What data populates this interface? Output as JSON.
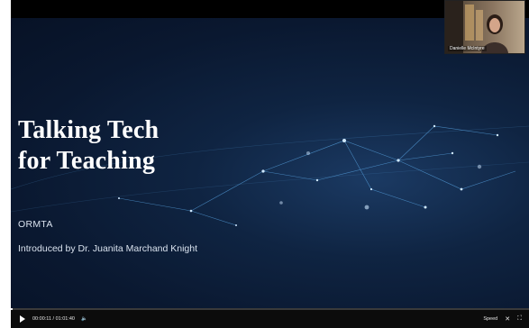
{
  "slide": {
    "title_line1": "Talking Tech",
    "title_line2": "for Teaching",
    "org": "ORMTA",
    "intro": "Introduced by Dr. Juanita Marchand Knight"
  },
  "webcam": {
    "participant_name": "Danielle McIntyre"
  },
  "controls": {
    "time": "00:00:11 / 01:01:40",
    "speed_label": "Speed",
    "progress_fraction": 0.003
  },
  "colors": {
    "slide_bg": "#0a1830",
    "network_line": "#5aa7e6"
  }
}
